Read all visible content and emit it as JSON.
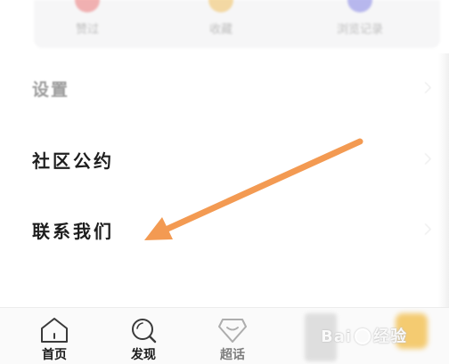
{
  "top_shortcuts": [
    {
      "label": "赞过",
      "color": "#e85a5a"
    },
    {
      "label": "收藏",
      "color": "#f0b43c"
    },
    {
      "label": "浏览记录",
      "color": "#6a6ae0"
    }
  ],
  "settings": {
    "section_title": "设置",
    "items": [
      {
        "label": "社区公约"
      },
      {
        "label": "联系我们"
      }
    ]
  },
  "annotation": {
    "arrow_color": "#f39a52"
  },
  "tabbar": {
    "tabs": [
      {
        "label": "首页",
        "icon": "home-icon"
      },
      {
        "label": "发现",
        "icon": "search-icon"
      },
      {
        "label": "超话",
        "icon": "diamond-icon"
      }
    ]
  },
  "watermark": {
    "text_left": "Bai",
    "text_right": "经验"
  }
}
